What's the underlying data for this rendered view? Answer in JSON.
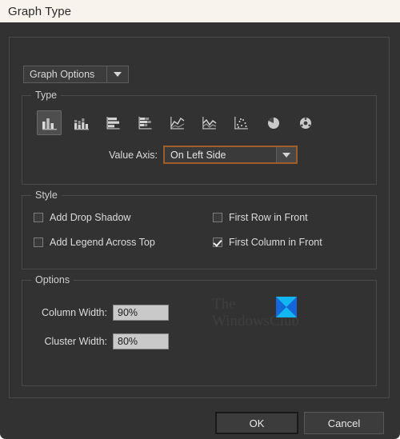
{
  "window": {
    "title": "Graph Type"
  },
  "graph_options": {
    "label": "Graph Options",
    "arrow_icon": "chevron-down-icon"
  },
  "type_section": {
    "legend": "Type",
    "icons": [
      {
        "name": "column-graph-icon",
        "label": "Column Graph",
        "selected": true
      },
      {
        "name": "stacked-column-graph-icon",
        "label": "Stacked Column Graph",
        "selected": false
      },
      {
        "name": "bar-graph-icon",
        "label": "Bar Graph",
        "selected": false
      },
      {
        "name": "stacked-bar-graph-icon",
        "label": "Stacked Bar Graph",
        "selected": false
      },
      {
        "name": "line-graph-icon",
        "label": "Line Graph",
        "selected": false
      },
      {
        "name": "area-graph-icon",
        "label": "Area Graph",
        "selected": false
      },
      {
        "name": "scatter-graph-icon",
        "label": "Scatter Graph",
        "selected": false
      },
      {
        "name": "pie-graph-icon",
        "label": "Pie Graph",
        "selected": false
      },
      {
        "name": "radar-graph-icon",
        "label": "Radar Graph",
        "selected": false
      }
    ],
    "value_axis": {
      "label": "Value Axis:",
      "value": "On Left Side",
      "arrow_icon": "chevron-down-icon"
    }
  },
  "style_section": {
    "legend": "Style",
    "checkboxes": [
      {
        "label": "Add Drop Shadow",
        "checked": false
      },
      {
        "label": "First Row in Front",
        "checked": false
      },
      {
        "label": "Add Legend Across Top",
        "checked": false
      },
      {
        "label": "First Column in Front",
        "checked": true
      }
    ]
  },
  "options_section": {
    "legend": "Options",
    "column_width": {
      "label": "Column Width:",
      "value": "90%"
    },
    "cluster_width": {
      "label": "Cluster Width:",
      "value": "80%"
    }
  },
  "watermark": {
    "line1": "The",
    "line2": "WindowsClub",
    "logo_icon": "windowsclub-logo-icon"
  },
  "buttons": {
    "ok": "OK",
    "cancel": "Cancel"
  },
  "colors": {
    "dialog_background": "#323232",
    "titlebar_background": "#f8f4ed",
    "focus_border": "#a05d2c",
    "input_background": "#c9c9c9",
    "logo_cyan": "#12b7f2",
    "logo_blue": "#1566d8"
  }
}
